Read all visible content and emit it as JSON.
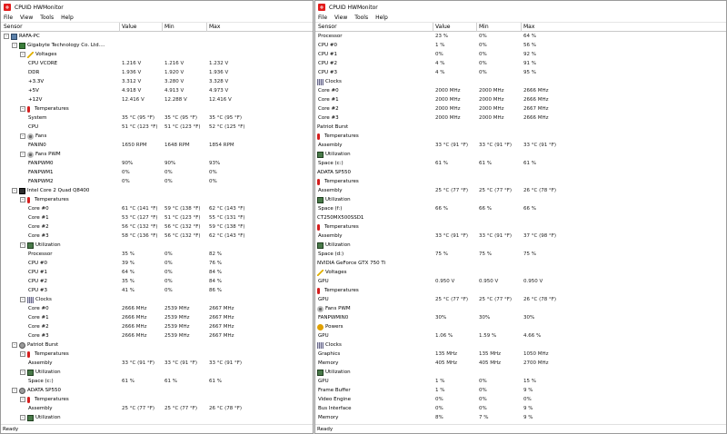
{
  "win1": {
    "title": "CPUID HWMonitor",
    "menu": [
      "File",
      "View",
      "Tools",
      "Help"
    ],
    "cols": [
      "Sensor",
      "Value",
      "Min",
      "Max"
    ],
    "status": "Ready",
    "rows": [
      {
        "l": 0,
        "exp": "-",
        "icon": "pc",
        "name": "RAFA-PC",
        "v": "",
        "mn": "",
        "mx": ""
      },
      {
        "l": 1,
        "exp": "-",
        "icon": "board",
        "name": "Gigabyte Technology Co. Ltd....",
        "v": "",
        "mn": "",
        "mx": ""
      },
      {
        "l": 2,
        "exp": "-",
        "icon": "volt",
        "name": "Voltages",
        "v": "",
        "mn": "",
        "mx": ""
      },
      {
        "l": 3,
        "name": "CPU VCORE",
        "v": "1.216 V",
        "mn": "1.216 V",
        "mx": "1.232 V"
      },
      {
        "l": 3,
        "name": "DDR",
        "v": "1.936 V",
        "mn": "1.920 V",
        "mx": "1.936 V"
      },
      {
        "l": 3,
        "name": "+3.3V",
        "v": "3.312 V",
        "mn": "3.280 V",
        "mx": "3.328 V"
      },
      {
        "l": 3,
        "name": "+5V",
        "v": "4.918 V",
        "mn": "4.913 V",
        "mx": "4.973 V"
      },
      {
        "l": 3,
        "name": "+12V",
        "v": "12.416 V",
        "mn": "12.288 V",
        "mx": "12.416 V"
      },
      {
        "l": 2,
        "exp": "-",
        "icon": "temp",
        "name": "Temperatures",
        "v": "",
        "mn": "",
        "mx": ""
      },
      {
        "l": 3,
        "name": "System",
        "v": "35 °C  (95 °F)",
        "mn": "35 °C  (95 °F)",
        "mx": "35 °C  (95 °F)"
      },
      {
        "l": 3,
        "name": "CPU",
        "v": "51 °C  (123 °F)",
        "mn": "51 °C  (123 °F)",
        "mx": "52 °C  (125 °F)"
      },
      {
        "l": 2,
        "exp": "-",
        "icon": "fan",
        "name": "Fans",
        "v": "",
        "mn": "",
        "mx": ""
      },
      {
        "l": 3,
        "name": "FANIN0",
        "v": "1650 RPM",
        "mn": "1648 RPM",
        "mx": "1854 RPM"
      },
      {
        "l": 2,
        "exp": "-",
        "icon": "fan",
        "name": "Fans PWM",
        "v": "",
        "mn": "",
        "mx": ""
      },
      {
        "l": 3,
        "name": "FANPWM0",
        "v": "90%",
        "mn": "90%",
        "mx": "93%"
      },
      {
        "l": 3,
        "name": "FANPWM1",
        "v": "0%",
        "mn": "0%",
        "mx": "0%"
      },
      {
        "l": 3,
        "name": "FANPWM2",
        "v": "0%",
        "mn": "0%",
        "mx": "0%"
      },
      {
        "l": 1,
        "exp": "-",
        "icon": "cpu",
        "name": "Intel Core 2 Quad Q8400",
        "v": "",
        "mn": "",
        "mx": ""
      },
      {
        "l": 2,
        "exp": "-",
        "icon": "temp",
        "name": "Temperatures",
        "v": "",
        "mn": "",
        "mx": ""
      },
      {
        "l": 3,
        "name": "Core #0",
        "v": "61 °C  (141 °F)",
        "mn": "59 °C  (138 °F)",
        "mx": "62 °C  (143 °F)"
      },
      {
        "l": 3,
        "name": "Core #1",
        "v": "53 °C  (127 °F)",
        "mn": "51 °C  (123 °F)",
        "mx": "55 °C  (131 °F)"
      },
      {
        "l": 3,
        "name": "Core #2",
        "v": "56 °C  (132 °F)",
        "mn": "56 °C  (132 °F)",
        "mx": "59 °C  (138 °F)"
      },
      {
        "l": 3,
        "name": "Core #3",
        "v": "58 °C  (136 °F)",
        "mn": "56 °C  (132 °F)",
        "mx": "62 °C  (143 °F)"
      },
      {
        "l": 2,
        "exp": "-",
        "icon": "util",
        "name": "Utilization",
        "v": "",
        "mn": "",
        "mx": ""
      },
      {
        "l": 3,
        "name": "Processor",
        "v": "35 %",
        "mn": "0%",
        "mx": "82 %"
      },
      {
        "l": 3,
        "name": "CPU #0",
        "v": "39 %",
        "mn": "0%",
        "mx": "76 %"
      },
      {
        "l": 3,
        "name": "CPU #1",
        "v": "64 %",
        "mn": "0%",
        "mx": "84 %"
      },
      {
        "l": 3,
        "name": "CPU #2",
        "v": "35 %",
        "mn": "0%",
        "mx": "84 %"
      },
      {
        "l": 3,
        "name": "CPU #3",
        "v": "41 %",
        "mn": "0%",
        "mx": "86 %"
      },
      {
        "l": 2,
        "exp": "-",
        "icon": "clock",
        "name": "Clocks",
        "v": "",
        "mn": "",
        "mx": ""
      },
      {
        "l": 3,
        "name": "Core #0",
        "v": "2666 MHz",
        "mn": "2539 MHz",
        "mx": "2667 MHz"
      },
      {
        "l": 3,
        "name": "Core #1",
        "v": "2666 MHz",
        "mn": "2539 MHz",
        "mx": "2667 MHz"
      },
      {
        "l": 3,
        "name": "Core #2",
        "v": "2666 MHz",
        "mn": "2539 MHz",
        "mx": "2667 MHz"
      },
      {
        "l": 3,
        "name": "Core #3",
        "v": "2666 MHz",
        "mn": "2539 MHz",
        "mx": "2667 MHz"
      },
      {
        "l": 1,
        "exp": "-",
        "icon": "disk",
        "name": "Patriot Burst",
        "v": "",
        "mn": "",
        "mx": ""
      },
      {
        "l": 2,
        "exp": "-",
        "icon": "temp",
        "name": "Temperatures",
        "v": "",
        "mn": "",
        "mx": ""
      },
      {
        "l": 3,
        "name": "Assembly",
        "v": "33 °C  (91 °F)",
        "mn": "33 °C  (91 °F)",
        "mx": "33 °C  (91 °F)"
      },
      {
        "l": 2,
        "exp": "-",
        "icon": "util",
        "name": "Utilization",
        "v": "",
        "mn": "",
        "mx": ""
      },
      {
        "l": 3,
        "name": "Space (c:)",
        "v": "61 %",
        "mn": "61 %",
        "mx": "61 %"
      },
      {
        "l": 1,
        "exp": "-",
        "icon": "disk",
        "name": "ADATA SP550",
        "v": "",
        "mn": "",
        "mx": ""
      },
      {
        "l": 2,
        "exp": "-",
        "icon": "temp",
        "name": "Temperatures",
        "v": "",
        "mn": "",
        "mx": ""
      },
      {
        "l": 3,
        "name": "Assembly",
        "v": "25 °C  (77 °F)",
        "mn": "25 °C  (77 °F)",
        "mx": "26 °C  (78 °F)"
      },
      {
        "l": 2,
        "exp": "-",
        "icon": "util",
        "name": "Utilization",
        "v": "",
        "mn": "",
        "mx": ""
      }
    ]
  },
  "win2": {
    "title": "CPUID HWMonitor",
    "menu": [
      "File",
      "View",
      "Tools",
      "Help"
    ],
    "cols": [
      "Sensor",
      "Value",
      "Min",
      "Max"
    ],
    "status": "Ready",
    "rows": [
      {
        "l": 3,
        "name": "Processor",
        "v": "23 %",
        "mn": "0%",
        "mx": "64 %"
      },
      {
        "l": 3,
        "name": "CPU #0",
        "v": "1 %",
        "mn": "0%",
        "mx": "56 %"
      },
      {
        "l": 3,
        "name": "CPU #1",
        "v": "0%",
        "mn": "0%",
        "mx": "92 %"
      },
      {
        "l": 3,
        "name": "CPU #2",
        "v": "4 %",
        "mn": "0%",
        "mx": "91 %"
      },
      {
        "l": 3,
        "name": "CPU #3",
        "v": "4 %",
        "mn": "0%",
        "mx": "95 %"
      },
      {
        "l": 2,
        "exp": "-",
        "icon": "clock",
        "name": "Clocks",
        "v": "",
        "mn": "",
        "mx": ""
      },
      {
        "l": 3,
        "name": "Core #0",
        "v": "2000 MHz",
        "mn": "2000 MHz",
        "mx": "2666 MHz"
      },
      {
        "l": 3,
        "name": "Core #1",
        "v": "2000 MHz",
        "mn": "2000 MHz",
        "mx": "2666 MHz"
      },
      {
        "l": 3,
        "name": "Core #2",
        "v": "2000 MHz",
        "mn": "2000 MHz",
        "mx": "2667 MHz"
      },
      {
        "l": 3,
        "name": "Core #3",
        "v": "2000 MHz",
        "mn": "2000 MHz",
        "mx": "2666 MHz"
      },
      {
        "l": 1,
        "exp": "-",
        "icon": "disk",
        "name": "Patriot Burst",
        "v": "",
        "mn": "",
        "mx": ""
      },
      {
        "l": 2,
        "exp": "-",
        "icon": "temp",
        "name": "Temperatures",
        "v": "",
        "mn": "",
        "mx": ""
      },
      {
        "l": 3,
        "name": "Assembly",
        "v": "33 °C  (91 °F)",
        "mn": "33 °C  (91 °F)",
        "mx": "33 °C  (91 °F)"
      },
      {
        "l": 2,
        "exp": "-",
        "icon": "util",
        "name": "Utilization",
        "v": "",
        "mn": "",
        "mx": ""
      },
      {
        "l": 3,
        "name": "Space (c:)",
        "v": "61 %",
        "mn": "61 %",
        "mx": "61 %"
      },
      {
        "l": 1,
        "exp": "-",
        "icon": "disk",
        "name": "ADATA SP550",
        "v": "",
        "mn": "",
        "mx": ""
      },
      {
        "l": 2,
        "exp": "-",
        "icon": "temp",
        "name": "Temperatures",
        "v": "",
        "mn": "",
        "mx": ""
      },
      {
        "l": 3,
        "name": "Assembly",
        "v": "25 °C  (77 °F)",
        "mn": "25 °C  (77 °F)",
        "mx": "26 °C  (78 °F)"
      },
      {
        "l": 2,
        "exp": "-",
        "icon": "util",
        "name": "Utilization",
        "v": "",
        "mn": "",
        "mx": ""
      },
      {
        "l": 3,
        "name": "Space (f:)",
        "v": "66 %",
        "mn": "66 %",
        "mx": "66 %"
      },
      {
        "l": 1,
        "exp": "-",
        "icon": "disk",
        "name": "CT250MX500SSD1",
        "v": "",
        "mn": "",
        "mx": ""
      },
      {
        "l": 2,
        "exp": "-",
        "icon": "temp",
        "name": "Temperatures",
        "v": "",
        "mn": "",
        "mx": ""
      },
      {
        "l": 3,
        "name": "Assembly",
        "v": "33 °C  (91 °F)",
        "mn": "33 °C  (91 °F)",
        "mx": "37 °C  (98 °F)"
      },
      {
        "l": 2,
        "exp": "-",
        "icon": "util",
        "name": "Utilization",
        "v": "",
        "mn": "",
        "mx": ""
      },
      {
        "l": 3,
        "name": "Space (d:)",
        "v": "75 %",
        "mn": "75 %",
        "mx": "75 %"
      },
      {
        "l": 1,
        "exp": "-",
        "icon": "gpu",
        "name": "NVIDIA GeForce GTX 750 Ti",
        "v": "",
        "mn": "",
        "mx": ""
      },
      {
        "l": 2,
        "exp": "-",
        "icon": "volt",
        "name": "Voltages",
        "v": "",
        "mn": "",
        "mx": ""
      },
      {
        "l": 3,
        "name": "GPU",
        "v": "0.950 V",
        "mn": "0.950 V",
        "mx": "0.950 V"
      },
      {
        "l": 2,
        "exp": "-",
        "icon": "temp",
        "name": "Temperatures",
        "v": "",
        "mn": "",
        "mx": ""
      },
      {
        "l": 3,
        "name": "GPU",
        "v": "25 °C  (77 °F)",
        "mn": "25 °C  (77 °F)",
        "mx": "26 °C  (78 °F)"
      },
      {
        "l": 2,
        "exp": "-",
        "icon": "fan",
        "name": "Fans PWM",
        "v": "",
        "mn": "",
        "mx": ""
      },
      {
        "l": 3,
        "name": "FANPWMIN0",
        "v": "30%",
        "mn": "30%",
        "mx": "30%"
      },
      {
        "l": 2,
        "exp": "-",
        "icon": "power",
        "name": "Powers",
        "v": "",
        "mn": "",
        "mx": ""
      },
      {
        "l": 3,
        "name": "GPU",
        "v": "1.06 %",
        "mn": "1.59 %",
        "mx": "4.66 %"
      },
      {
        "l": 2,
        "exp": "-",
        "icon": "clock",
        "name": "Clocks",
        "v": "",
        "mn": "",
        "mx": ""
      },
      {
        "l": 3,
        "name": "Graphics",
        "v": "135 MHz",
        "mn": "135 MHz",
        "mx": "1050 MHz"
      },
      {
        "l": 3,
        "name": "Memory",
        "v": "405 MHz",
        "mn": "405 MHz",
        "mx": "2700 MHz"
      },
      {
        "l": 2,
        "exp": "-",
        "icon": "util",
        "name": "Utilization",
        "v": "",
        "mn": "",
        "mx": ""
      },
      {
        "l": 3,
        "name": "GPU",
        "v": "1 %",
        "mn": "0%",
        "mx": "15 %"
      },
      {
        "l": 3,
        "name": "Frame Buffer",
        "v": "1 %",
        "mn": "0%",
        "mx": "9 %"
      },
      {
        "l": 3,
        "name": "Video Engine",
        "v": "0%",
        "mn": "0%",
        "mx": "0%"
      },
      {
        "l": 3,
        "name": "Bus Interface",
        "v": "0%",
        "mn": "0%",
        "mx": "9 %"
      },
      {
        "l": 3,
        "name": "Memory",
        "v": "8%",
        "mn": "7 %",
        "mx": "9 %"
      }
    ]
  }
}
